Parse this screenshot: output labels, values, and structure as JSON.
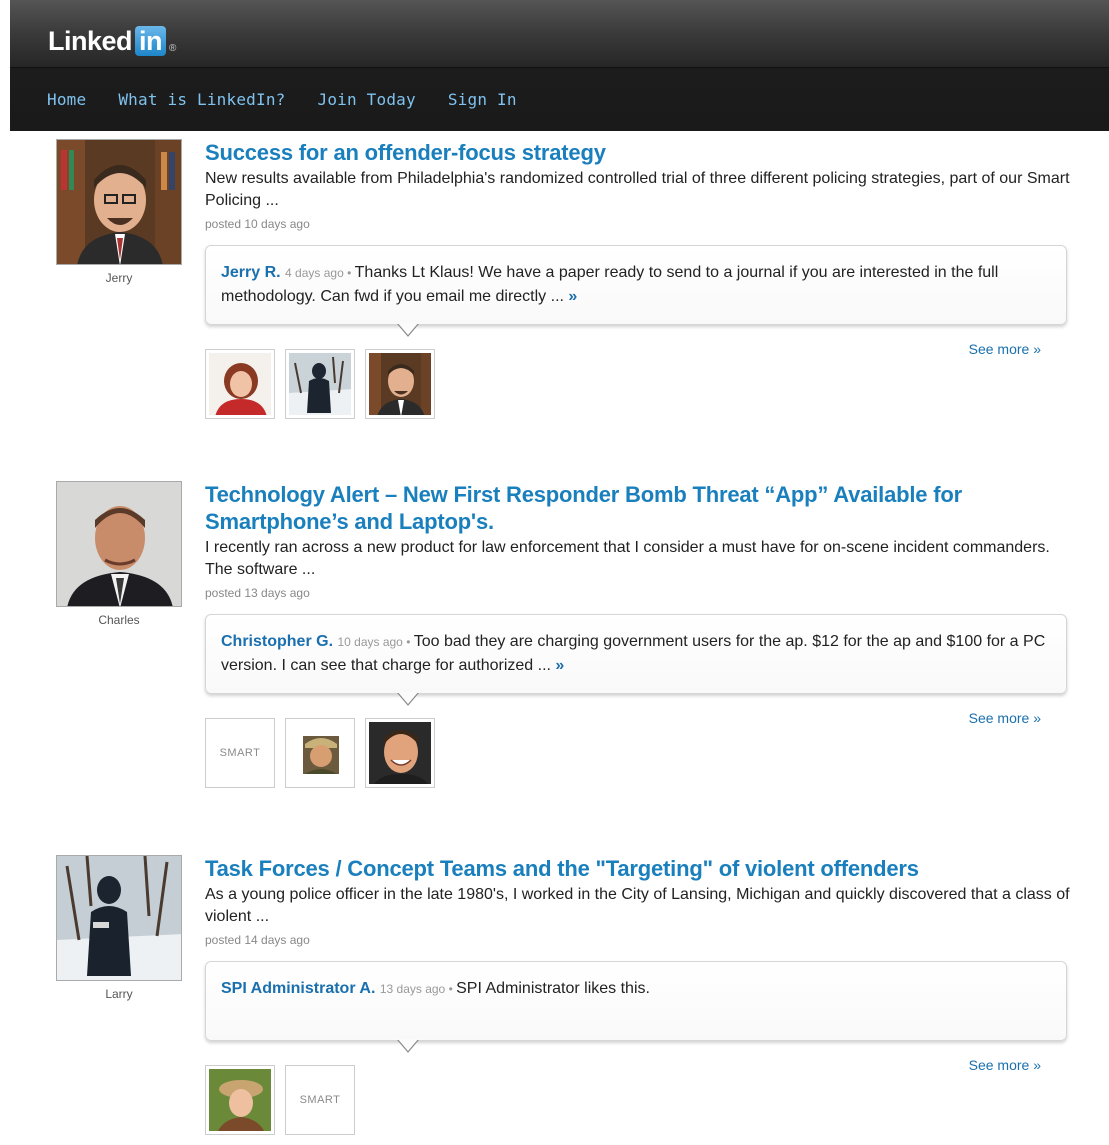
{
  "header": {
    "logo_word": "Linked",
    "logo_in": "in",
    "logo_reg": "®",
    "nav": [
      "Home",
      "What is LinkedIn?",
      "Join Today",
      "Sign In"
    ]
  },
  "colors": {
    "link_blue": "#1a7fbd",
    "nav_blue": "#7fc2ee",
    "header_dark": "#1c1c1c"
  },
  "posts": [
    {
      "author": "Jerry",
      "title": "Success for an offender-focus strategy",
      "excerpt": "New results available from Philadelphia's randomized controlled trial of three different policing strategies, part of our Smart Policing ...",
      "posted": "posted 10 days ago",
      "comment": {
        "name": "Jerry R.",
        "time": "4 days ago",
        "sep": " • ",
        "text": "Thanks Lt Klaus! We have a paper ready to send to a journal if you are interested in the full methodology. Can fwd if you email me directly ... ",
        "more": "»"
      },
      "see_more": "See more »",
      "avatars": [
        "woman-portrait",
        "police-officer-snow",
        "jerry-portrait"
      ]
    },
    {
      "author": "Charles",
      "title": "Technology Alert – New First Responder Bomb Threat “App” Available for Smartphone’s and Laptop's.",
      "excerpt": "I recently ran across a new product for law enforcement that I consider a must have for on-scene incident commanders. The software ...",
      "posted": "posted 13 days ago",
      "comment": {
        "name": "Christopher G.",
        "time": "10 days ago",
        "sep": " • ",
        "text": "Too bad they are charging government users for the ap. $12 for the ap and $100 for a PC version. I can see that charge for authorized ... ",
        "more": "»"
      },
      "see_more": "See more »",
      "avatars": [
        "smart-logo",
        "man-hat-portrait",
        "man-smiling-portrait"
      ]
    },
    {
      "author": "Larry",
      "title": "Task Forces / Concept Teams and the \"Targeting\" of violent offenders",
      "excerpt": "As a young police officer in the late 1980's, I worked in the City of Lansing, Michigan and quickly discovered that a class of violent ...",
      "posted": "posted 14 days ago",
      "comment": {
        "name": "SPI Administrator A.",
        "time": "13 days ago",
        "sep": " • ",
        "text": "SPI Administrator likes this.",
        "more": ""
      },
      "see_more": "See more »",
      "avatars": [
        "woman-hat-portrait",
        "smart-logo"
      ],
      "smart_logo_text": "SMART"
    }
  ],
  "smart_logo_text": "SMART"
}
